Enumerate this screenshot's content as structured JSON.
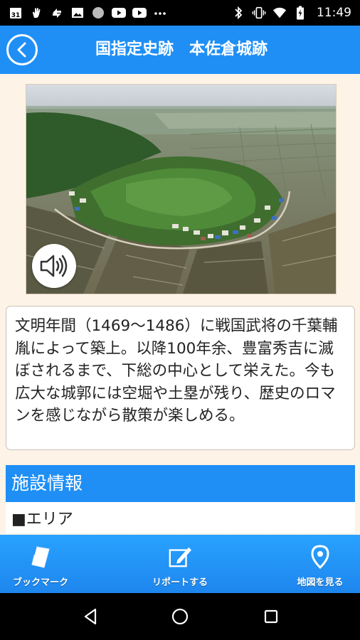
{
  "status_bar": {
    "time": "11:49",
    "left_icons": [
      "calendar-31-icon",
      "hand-icon",
      "sync-icon",
      "image-icon",
      "circle-icon",
      "youtube-icon",
      "youtube-icon",
      "more-icon"
    ],
    "calendar_day": "31",
    "right_icons": [
      "bluetooth-icon",
      "vibrate-icon",
      "wifi-icon",
      "battery-charging-icon"
    ]
  },
  "header": {
    "title": "国指定史跡　本佐倉城跡",
    "back_icon": "chevron-left-circle-icon",
    "color": "#1f8ff5"
  },
  "photo": {
    "subject": "aerial-view-castle-ruins",
    "sound_icon": "speaker-icon"
  },
  "description": {
    "text": "文明年間（1469～1486）に戦国武将の千葉輔胤によって築上。以降100年余、豊富秀吉に滅ぼされるまで、下総の中心として栄えた。今も広大な城郭には空堀や土塁が残り、歴史のロマンを感じながら散策が楽しめる。"
  },
  "facility": {
    "section_title": "施設情報",
    "area_label": "■エリア"
  },
  "toolbar": {
    "bookmark_label": "ブックマーク",
    "report_label": "リポートする",
    "map_label": "地図を見る"
  },
  "nav_bar": {
    "back_icon": "nav-back-icon",
    "home_icon": "nav-home-icon",
    "recents_icon": "nav-recents-icon"
  }
}
